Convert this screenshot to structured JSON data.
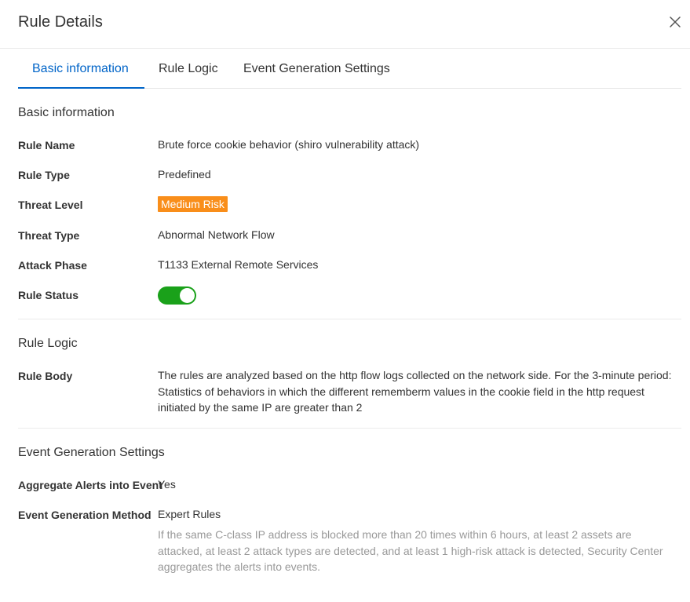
{
  "dialog": {
    "title": "Rule Details"
  },
  "tabs": [
    {
      "label": "Basic information",
      "active": true
    },
    {
      "label": "Rule Logic",
      "active": false
    },
    {
      "label": "Event Generation Settings",
      "active": false
    }
  ],
  "basic": {
    "section_title": "Basic information",
    "rule_name_label": "Rule Name",
    "rule_name_value": "Brute force cookie behavior (shiro vulnerability attack)",
    "rule_type_label": "Rule Type",
    "rule_type_value": "Predefined",
    "threat_level_label": "Threat Level",
    "threat_level_value": "Medium Risk",
    "threat_type_label": "Threat Type",
    "threat_type_value": "Abnormal Network Flow",
    "attack_phase_label": "Attack Phase",
    "attack_phase_value": "T1133 External Remote Services",
    "rule_status_label": "Rule Status",
    "rule_status_on": true
  },
  "logic": {
    "section_title": "Rule Logic",
    "rule_body_label": "Rule Body",
    "rule_body_value": "The rules are analyzed based on the http flow logs collected on the network side. For the 3-minute period: Statistics of behaviors in which the different rememberm values in the cookie field in the http request initiated by the same IP are greater than 2"
  },
  "event": {
    "section_title": "Event Generation Settings",
    "aggregate_label": "Aggregate Alerts into Event",
    "aggregate_value": "Yes",
    "method_label": "Event Generation Method",
    "method_value": "Expert Rules",
    "method_description": "If the same C-class IP address is blocked more than 20 times within 6 hours, at least 2 assets are attacked, at least 2 attack types are detected, and at least 1 high-risk attack is detected, Security Center aggregates the alerts into events."
  },
  "colors": {
    "accent": "#0064c8",
    "badge_medium": "#f98e1a",
    "switch_on": "#1aa11a",
    "hint_text": "#999999"
  },
  "icons": {
    "close": "close-icon"
  }
}
